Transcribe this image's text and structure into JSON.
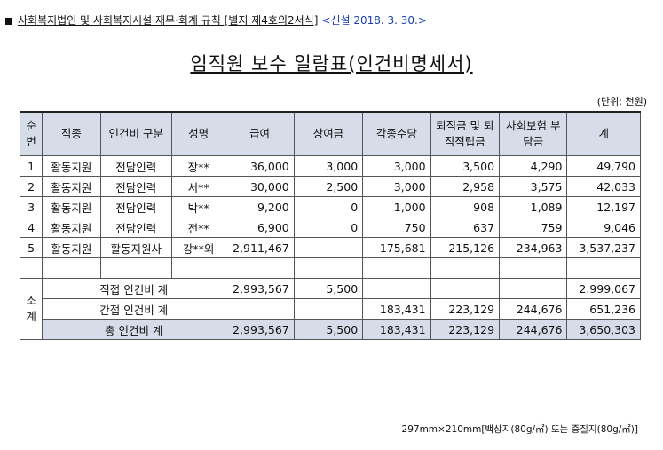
{
  "header": {
    "regulation": "사회복지법인 및 사회복지시설 재무·회계 규칙 [별지 제4호의2서식]",
    "revision": "<신설 2018. 3. 30.>"
  },
  "title": "임직원 보수 일람표(인건비명세서)",
  "unit": "(단위: 천원)",
  "columns": [
    "순번",
    "직종",
    "인건비 구분",
    "성명",
    "급여",
    "상여금",
    "각종수당",
    "퇴직금 및 퇴직적립금",
    "사회보험 부담금",
    "계"
  ],
  "rows": [
    {
      "no": "1",
      "job": "활동지원",
      "type": "전담인력",
      "name": "장**",
      "salary": "36,000",
      "bonus": "3,000",
      "allowance": "3,000",
      "retire": "3,500",
      "insurance": "4,290",
      "total": "49,790"
    },
    {
      "no": "2",
      "job": "활동지원",
      "type": "전담인력",
      "name": "서**",
      "salary": "30,000",
      "bonus": "2,500",
      "allowance": "3,000",
      "retire": "2,958",
      "insurance": "3,575",
      "total": "42,033"
    },
    {
      "no": "3",
      "job": "활동지원",
      "type": "전담인력",
      "name": "박**",
      "salary": "9,200",
      "bonus": "0",
      "allowance": "1,000",
      "retire": "908",
      "insurance": "1,089",
      "total": "12,197"
    },
    {
      "no": "4",
      "job": "활동지원",
      "type": "전담인력",
      "name": "전**",
      "salary": "6,900",
      "bonus": "0",
      "allowance": "750",
      "retire": "637",
      "insurance": "759",
      "total": "9,046"
    },
    {
      "no": "5",
      "job": "활동지원",
      "type": "활동지원사",
      "name": "강**외",
      "salary": "2,911,467",
      "bonus": "",
      "allowance": "175,681",
      "retire": "215,126",
      "insurance": "234,963",
      "total": "3,537,237"
    }
  ],
  "subtotal_label": "소 계",
  "direct": {
    "label": "직접 인건비 계",
    "salary": "2,993,567",
    "bonus": "5,500",
    "allowance": "",
    "retire": "",
    "insurance": "",
    "total": "2.999,067"
  },
  "indirect": {
    "label": "간접 인건비 계",
    "salary": "",
    "bonus": "",
    "allowance": "183,431",
    "retire": "223,129",
    "insurance": "244,676",
    "total": "651,236"
  },
  "grand": {
    "label": "총 인건비 계",
    "salary": "2,993,567",
    "bonus": "5,500",
    "allowance": "183,431",
    "retire": "223,129",
    "insurance": "244,676",
    "total": "3,650,303"
  },
  "footer": "297mm×210mm[백상지(80g/㎡) 또는 중질지(80g/㎡)]"
}
